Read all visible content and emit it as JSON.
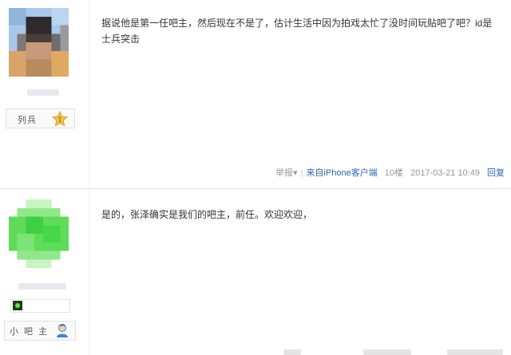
{
  "posts": [
    {
      "user": {
        "badge_label": "列兵",
        "level": "1"
      },
      "content": "据说他是第一任吧主，然后现在不是了，估计生活中因为拍戏太忙了没时间玩贴吧了吧？id是士兵突击",
      "meta": {
        "report": "举报",
        "report_arrow": "▾",
        "separator": "|",
        "device": "来自iPhone客户端",
        "floor": "10楼",
        "time": "2017-03-21 10:49",
        "reply": "回复"
      }
    },
    {
      "user": {
        "badge_label": "小 吧 主"
      },
      "content": "是的，张泽确实是我们的吧主，前任。欢迎欢迎，"
    }
  ],
  "colors": {
    "link": "#2d64b3",
    "meta_gray": "#999999",
    "divider": "#e6e6e6"
  }
}
